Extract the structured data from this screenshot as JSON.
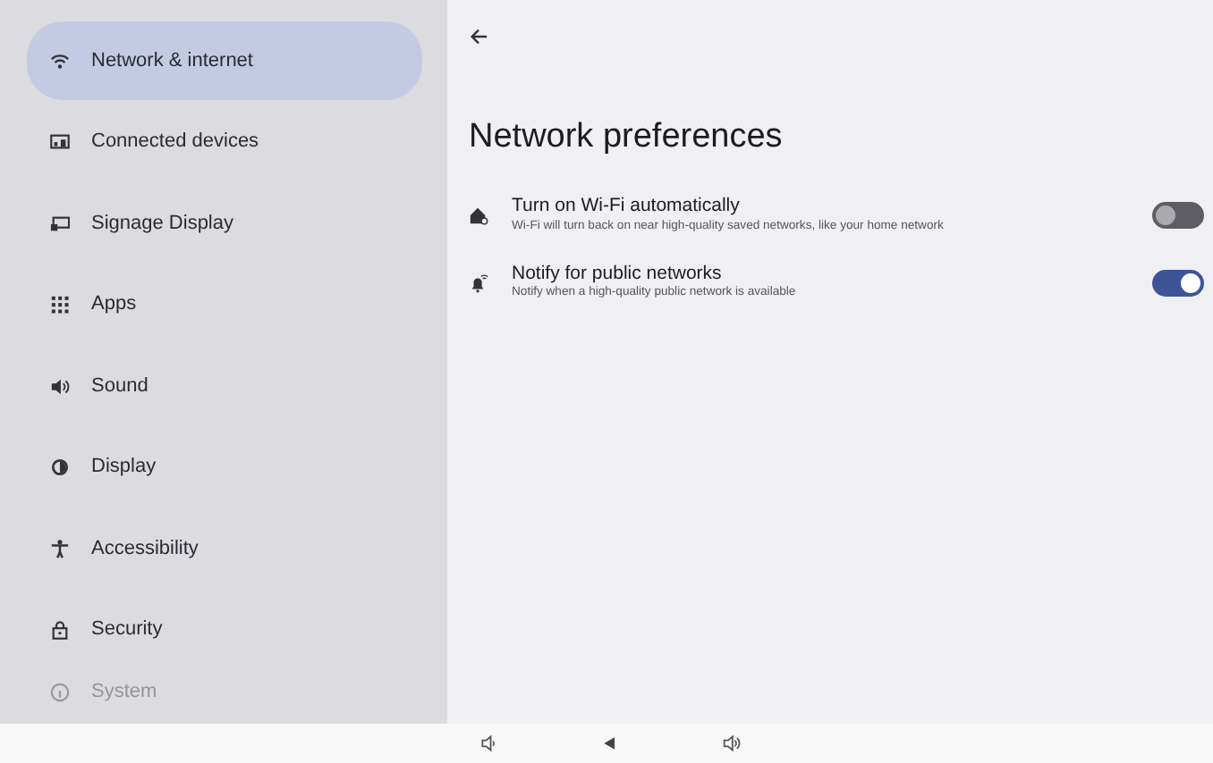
{
  "sidebar": {
    "items": [
      {
        "label": "Network & internet",
        "kind": "wifi",
        "selected": true
      },
      {
        "label": "Connected devices",
        "kind": "devices",
        "selected": false
      },
      {
        "label": "Signage Display",
        "kind": "display",
        "selected": false
      },
      {
        "label": "Apps",
        "kind": "apps",
        "selected": false
      },
      {
        "label": "Sound",
        "kind": "sound",
        "selected": false
      },
      {
        "label": "Display",
        "kind": "brightness",
        "selected": false
      },
      {
        "label": "Accessibility",
        "kind": "accessibility",
        "selected": false
      },
      {
        "label": "Security",
        "kind": "lock",
        "selected": false
      },
      {
        "label": "System",
        "kind": "info",
        "selected": false,
        "faded": true
      }
    ]
  },
  "page": {
    "title": "Network preferences",
    "settings": [
      {
        "title": "Turn on Wi-Fi automatically",
        "summary": "Wi-Fi will turn back on near high-quality saved networks, like your home network",
        "kind": "wifi-home",
        "checked": false
      },
      {
        "title": "Notify for public networks",
        "summary": "Notify when a high-quality public network is available",
        "kind": "wifi-bell",
        "checked": true
      }
    ]
  },
  "nav_bar": {
    "buttons": [
      {
        "kind": "volume-down"
      },
      {
        "kind": "back"
      },
      {
        "kind": "volume-up"
      }
    ]
  }
}
